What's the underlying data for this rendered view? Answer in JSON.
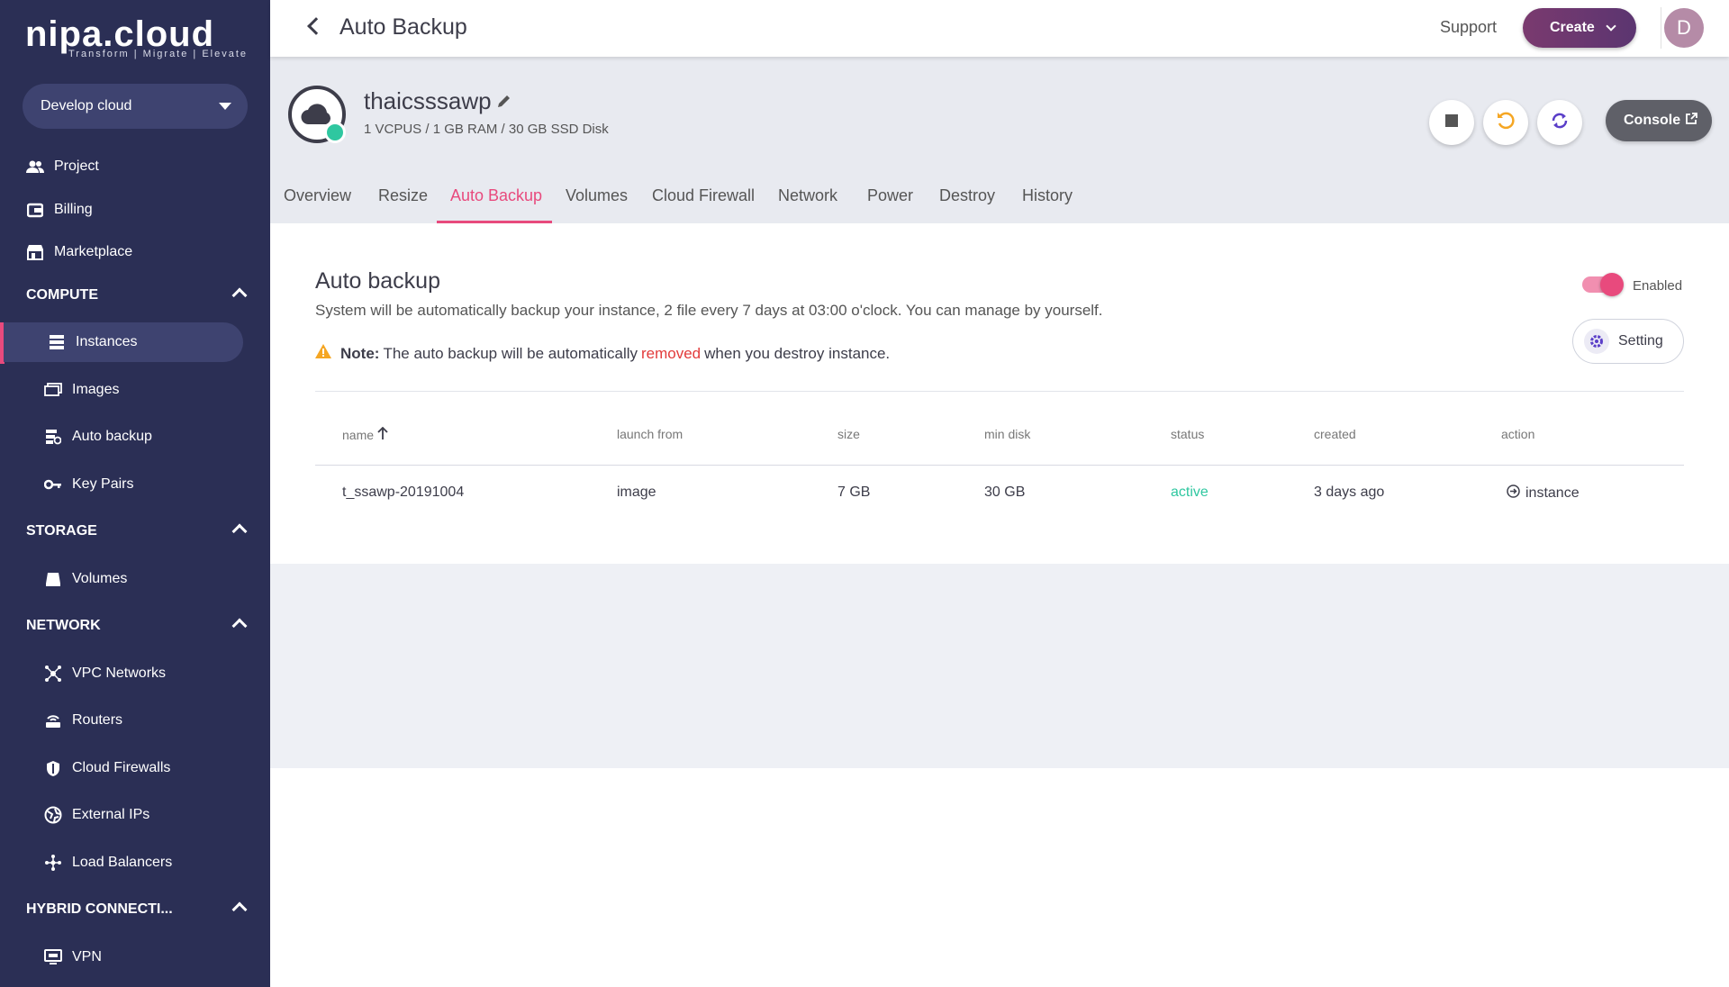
{
  "brand": {
    "name": "nipa.cloud",
    "tagline": "Transform | Migrate | Elevate"
  },
  "sidebar": {
    "project": "Develop cloud",
    "top_items": [
      {
        "label": "Project",
        "icon": "people-icon"
      },
      {
        "label": "Billing",
        "icon": "billing-icon"
      },
      {
        "label": "Marketplace",
        "icon": "store-icon"
      }
    ],
    "sections": {
      "compute": "COMPUTE",
      "storage": "STORAGE",
      "network": "NETWORK",
      "hybrid": "HYBRID CONNECTI..."
    },
    "compute_items": [
      {
        "label": "Instances",
        "icon": "server-icon"
      },
      {
        "label": "Images",
        "icon": "images-icon"
      },
      {
        "label": "Auto backup",
        "icon": "backup-icon"
      },
      {
        "label": "Key Pairs",
        "icon": "key-icon"
      }
    ],
    "storage_items": [
      {
        "label": "Volumes",
        "icon": "disk-icon"
      }
    ],
    "network_items": [
      {
        "label": "VPC Networks",
        "icon": "network-icon"
      },
      {
        "label": "Routers",
        "icon": "router-icon"
      },
      {
        "label": "Cloud Firewalls",
        "icon": "shield-icon"
      },
      {
        "label": "External IPs",
        "icon": "globe-icon"
      },
      {
        "label": "Load Balancers",
        "icon": "balancer-icon"
      }
    ],
    "hybrid_items": [
      {
        "label": "VPN",
        "icon": "vpn-icon"
      }
    ]
  },
  "topbar": {
    "title": "Auto Backup",
    "support": "Support",
    "create": "Create",
    "avatar": "D"
  },
  "instance": {
    "name": "thaicsssawp",
    "spec": "1 VCPUS / 1 GB RAM / 30 GB SSD Disk",
    "console": "Console"
  },
  "tabs": [
    "Overview",
    "Resize",
    "Auto Backup",
    "Volumes",
    "Cloud Firewall",
    "Network",
    "Power",
    "Destroy",
    "History"
  ],
  "active_tab": "Auto Backup",
  "backup": {
    "title": "Auto backup",
    "description": "System will be automatically backup your instance, 2 file every 7 days at 03:00 o'clock. You can manage by yourself.",
    "note_label": "Note:",
    "note_before": "The auto backup will be automatically",
    "note_removed": "removed",
    "note_after": "when you destroy instance.",
    "toggle_label": "Enabled",
    "toggle_on": true,
    "setting": "Setting"
  },
  "table": {
    "headers": [
      "name",
      "launch from",
      "size",
      "min disk",
      "status",
      "created",
      "action"
    ],
    "rows": [
      {
        "name": "t_ssawp-20191004",
        "launch_from": "image",
        "size": "7 GB",
        "min_disk": "30 GB",
        "status": "active",
        "created": "3 days ago",
        "action": "instance"
      }
    ]
  },
  "colors": {
    "accent": "#e84a7d",
    "sidebar": "#2b2f55",
    "active_status": "#2fc7a0",
    "warning": "#f5a623"
  }
}
